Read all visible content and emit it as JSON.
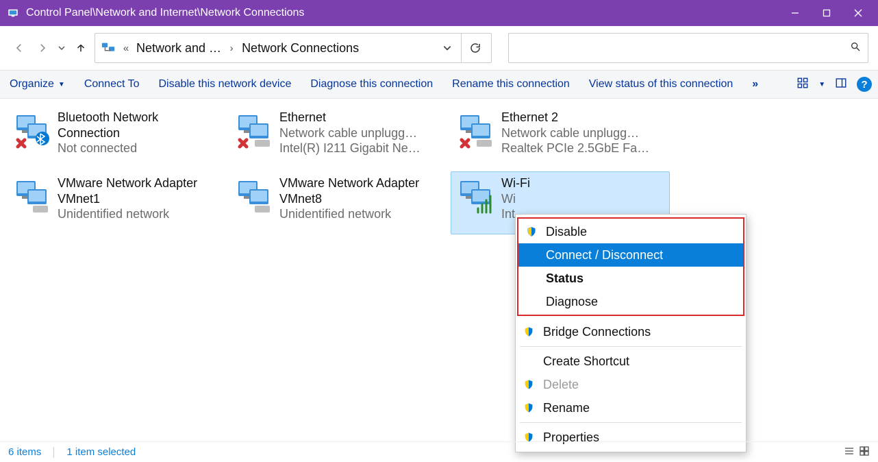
{
  "window": {
    "title": "Control Panel\\Network and Internet\\Network Connections"
  },
  "breadcrumb": {
    "item1": "Network and …",
    "item2": "Network Connections"
  },
  "search": {
    "placeholder": ""
  },
  "cmdbar": {
    "organize": "Organize",
    "connect_to": "Connect To",
    "disable": "Disable this network device",
    "diagnose": "Diagnose this connection",
    "rename": "Rename this connection",
    "view_status": "View status of this connection"
  },
  "items": [
    {
      "name": "Bluetooth Network Connection",
      "status": "Not connected",
      "detail": "",
      "overlay": "bt-x"
    },
    {
      "name": "Ethernet",
      "status": "Network cable unplugg…",
      "detail": "Intel(R) I211 Gigabit Ne…",
      "overlay": "x"
    },
    {
      "name": "Ethernet 2",
      "status": "Network cable unplugg…",
      "detail": "Realtek PCIe 2.5GbE Fa…",
      "overlay": "x"
    },
    {
      "name": "VMware Network Adapter VMnet1",
      "status": "Unidentified network",
      "detail": "",
      "overlay": "vm"
    },
    {
      "name": "VMware Network Adapter VMnet8",
      "status": "Unidentified network",
      "detail": "",
      "overlay": "vm"
    },
    {
      "name": "Wi-Fi",
      "status": "Wi",
      "detail": "Int",
      "overlay": "wifi",
      "selected": true
    }
  ],
  "context_menu": {
    "disable": "Disable",
    "connect_disconnect": "Connect / Disconnect",
    "status": "Status",
    "diagnose": "Diagnose",
    "bridge": "Bridge Connections",
    "create_shortcut": "Create Shortcut",
    "delete": "Delete",
    "rename": "Rename",
    "properties": "Properties"
  },
  "statusbar": {
    "count": "6 items",
    "selected": "1 item selected"
  }
}
